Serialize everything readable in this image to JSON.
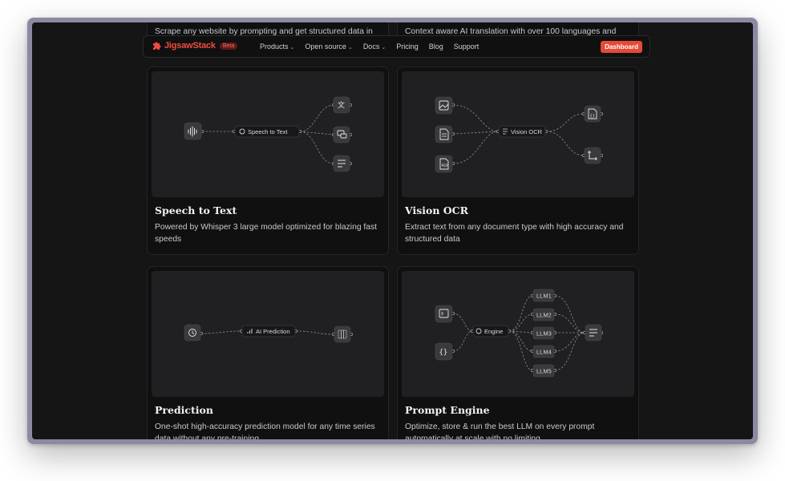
{
  "nav": {
    "brand": "JigsawStack",
    "badge": "Beta",
    "links": [
      "Products",
      "Open source",
      "Docs",
      "Pricing",
      "Blog",
      "Support"
    ],
    "dashboard": "Dashboard"
  },
  "top_cards": [
    {
      "desc": "Scrape any website by prompting and get structured data in"
    },
    {
      "desc": "Context aware AI translation with over 100 languages and"
    }
  ],
  "cards": [
    {
      "title": "Speech to Text",
      "desc": "Powered by Whisper 3 large model optimized for blazing fast speeds",
      "diagram": {
        "center": "Speech to Text",
        "icons": [
          "audio-wave-icon",
          "translate-icon",
          "chat-icon",
          "text-lines-icon"
        ]
      }
    },
    {
      "title": "Vision OCR",
      "desc": "Extract text from any document type with high accuracy and structured data",
      "diagram": {
        "center": "Vision OCR",
        "icons": [
          "image-icon",
          "document-icon",
          "pdf-icon",
          "json-file-icon",
          "crop-icon"
        ]
      }
    },
    {
      "title": "Prediction",
      "desc": "One-shot high-accuracy prediction model for any time series data without any pre-training",
      "diagram": {
        "center": "AI Prediction",
        "icons": [
          "history-icon",
          "table-grid-icon"
        ]
      }
    },
    {
      "title": "Prompt Engine",
      "desc": "Optimize, store & run the best LLM on every prompt automatically at scale with no limiting",
      "diagram": {
        "center": "Engine",
        "llms": [
          "LLM1",
          "LLM2",
          "LLM3",
          "LLM4",
          "LLM5"
        ],
        "icons": [
          "terminal-icon",
          "braces-icon",
          "text-lines-icon"
        ]
      }
    }
  ]
}
